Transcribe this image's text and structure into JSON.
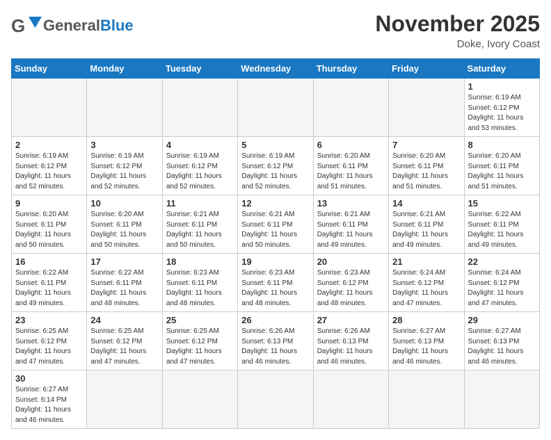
{
  "header": {
    "logo_general": "General",
    "logo_blue": "Blue",
    "month_title": "November 2025",
    "location": "Doke, Ivory Coast"
  },
  "days_of_week": [
    "Sunday",
    "Monday",
    "Tuesday",
    "Wednesday",
    "Thursday",
    "Friday",
    "Saturday"
  ],
  "weeks": [
    [
      {
        "day": "",
        "info": ""
      },
      {
        "day": "",
        "info": ""
      },
      {
        "day": "",
        "info": ""
      },
      {
        "day": "",
        "info": ""
      },
      {
        "day": "",
        "info": ""
      },
      {
        "day": "",
        "info": ""
      },
      {
        "day": "1",
        "info": "Sunrise: 6:19 AM\nSunset: 6:12 PM\nDaylight: 11 hours\nand 53 minutes."
      }
    ],
    [
      {
        "day": "2",
        "info": "Sunrise: 6:19 AM\nSunset: 6:12 PM\nDaylight: 11 hours\nand 52 minutes."
      },
      {
        "day": "3",
        "info": "Sunrise: 6:19 AM\nSunset: 6:12 PM\nDaylight: 11 hours\nand 52 minutes."
      },
      {
        "day": "4",
        "info": "Sunrise: 6:19 AM\nSunset: 6:12 PM\nDaylight: 11 hours\nand 52 minutes."
      },
      {
        "day": "5",
        "info": "Sunrise: 6:19 AM\nSunset: 6:12 PM\nDaylight: 11 hours\nand 52 minutes."
      },
      {
        "day": "6",
        "info": "Sunrise: 6:20 AM\nSunset: 6:11 PM\nDaylight: 11 hours\nand 51 minutes."
      },
      {
        "day": "7",
        "info": "Sunrise: 6:20 AM\nSunset: 6:11 PM\nDaylight: 11 hours\nand 51 minutes."
      },
      {
        "day": "8",
        "info": "Sunrise: 6:20 AM\nSunset: 6:11 PM\nDaylight: 11 hours\nand 51 minutes."
      }
    ],
    [
      {
        "day": "9",
        "info": "Sunrise: 6:20 AM\nSunset: 6:11 PM\nDaylight: 11 hours\nand 50 minutes."
      },
      {
        "day": "10",
        "info": "Sunrise: 6:20 AM\nSunset: 6:11 PM\nDaylight: 11 hours\nand 50 minutes."
      },
      {
        "day": "11",
        "info": "Sunrise: 6:21 AM\nSunset: 6:11 PM\nDaylight: 11 hours\nand 50 minutes."
      },
      {
        "day": "12",
        "info": "Sunrise: 6:21 AM\nSunset: 6:11 PM\nDaylight: 11 hours\nand 50 minutes."
      },
      {
        "day": "13",
        "info": "Sunrise: 6:21 AM\nSunset: 6:11 PM\nDaylight: 11 hours\nand 49 minutes."
      },
      {
        "day": "14",
        "info": "Sunrise: 6:21 AM\nSunset: 6:11 PM\nDaylight: 11 hours\nand 49 minutes."
      },
      {
        "day": "15",
        "info": "Sunrise: 6:22 AM\nSunset: 6:11 PM\nDaylight: 11 hours\nand 49 minutes."
      }
    ],
    [
      {
        "day": "16",
        "info": "Sunrise: 6:22 AM\nSunset: 6:11 PM\nDaylight: 11 hours\nand 49 minutes."
      },
      {
        "day": "17",
        "info": "Sunrise: 6:22 AM\nSunset: 6:11 PM\nDaylight: 11 hours\nand 48 minutes."
      },
      {
        "day": "18",
        "info": "Sunrise: 6:23 AM\nSunset: 6:11 PM\nDaylight: 11 hours\nand 48 minutes."
      },
      {
        "day": "19",
        "info": "Sunrise: 6:23 AM\nSunset: 6:11 PM\nDaylight: 11 hours\nand 48 minutes."
      },
      {
        "day": "20",
        "info": "Sunrise: 6:23 AM\nSunset: 6:12 PM\nDaylight: 11 hours\nand 48 minutes."
      },
      {
        "day": "21",
        "info": "Sunrise: 6:24 AM\nSunset: 6:12 PM\nDaylight: 11 hours\nand 47 minutes."
      },
      {
        "day": "22",
        "info": "Sunrise: 6:24 AM\nSunset: 6:12 PM\nDaylight: 11 hours\nand 47 minutes."
      }
    ],
    [
      {
        "day": "23",
        "info": "Sunrise: 6:25 AM\nSunset: 6:12 PM\nDaylight: 11 hours\nand 47 minutes."
      },
      {
        "day": "24",
        "info": "Sunrise: 6:25 AM\nSunset: 6:12 PM\nDaylight: 11 hours\nand 47 minutes."
      },
      {
        "day": "25",
        "info": "Sunrise: 6:25 AM\nSunset: 6:12 PM\nDaylight: 11 hours\nand 47 minutes."
      },
      {
        "day": "26",
        "info": "Sunrise: 6:26 AM\nSunset: 6:13 PM\nDaylight: 11 hours\nand 46 minutes."
      },
      {
        "day": "27",
        "info": "Sunrise: 6:26 AM\nSunset: 6:13 PM\nDaylight: 11 hours\nand 46 minutes."
      },
      {
        "day": "28",
        "info": "Sunrise: 6:27 AM\nSunset: 6:13 PM\nDaylight: 11 hours\nand 46 minutes."
      },
      {
        "day": "29",
        "info": "Sunrise: 6:27 AM\nSunset: 6:13 PM\nDaylight: 11 hours\nand 46 minutes."
      }
    ],
    [
      {
        "day": "30",
        "info": "Sunrise: 6:27 AM\nSunset: 6:14 PM\nDaylight: 11 hours\nand 46 minutes."
      },
      {
        "day": "",
        "info": ""
      },
      {
        "day": "",
        "info": ""
      },
      {
        "day": "",
        "info": ""
      },
      {
        "day": "",
        "info": ""
      },
      {
        "day": "",
        "info": ""
      },
      {
        "day": "",
        "info": ""
      }
    ]
  ]
}
